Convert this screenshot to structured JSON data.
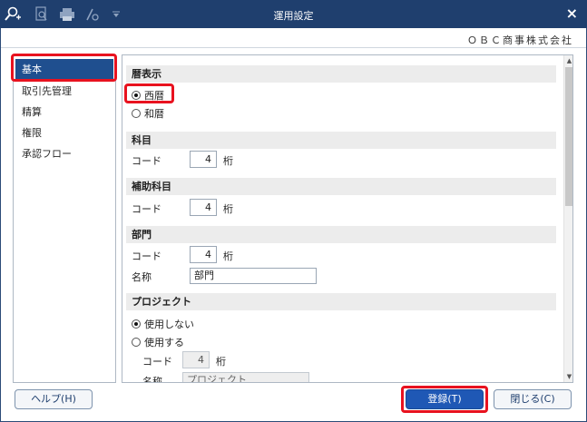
{
  "window": {
    "title": "運用設定",
    "close_label": "×"
  },
  "toolbar": {
    "icons": [
      "search-plus-icon",
      "search-doc-icon",
      "printer-icon",
      "pen-settings-icon",
      "dropdown-icon"
    ]
  },
  "company": "ＯＢＣ商事株式会社",
  "sidebar": {
    "items": [
      {
        "label": "基本",
        "active": true
      },
      {
        "label": "取引先管理"
      },
      {
        "label": "精算"
      },
      {
        "label": "権限"
      },
      {
        "label": "承認フロー"
      }
    ]
  },
  "sections": {
    "calendar": {
      "title": "暦表示",
      "options": [
        {
          "label": "西暦",
          "checked": true
        },
        {
          "label": "和暦",
          "checked": false
        }
      ]
    },
    "account": {
      "title": "科目",
      "code_label": "コード",
      "code_value": "4",
      "unit": "桁"
    },
    "sub_account": {
      "title": "補助科目",
      "code_label": "コード",
      "code_value": "4",
      "unit": "桁"
    },
    "department": {
      "title": "部門",
      "code_label": "コード",
      "code_value": "4",
      "unit": "桁",
      "name_label": "名称",
      "name_value": "部門"
    },
    "project": {
      "title": "プロジェクト",
      "options": [
        {
          "label": "使用しない",
          "checked": true
        },
        {
          "label": "使用する",
          "checked": false
        }
      ],
      "code_label": "コード",
      "code_value": "4",
      "unit": "桁",
      "name_label": "名称",
      "name_value": "プロジェクト"
    }
  },
  "buttons": {
    "help": "ヘルプ(H)",
    "register": "登録(T)",
    "close": "閉じる(C)"
  },
  "colors": {
    "titlebar": "#1f3f6e",
    "accent": "#1f58b5",
    "highlight": "#e8121f"
  }
}
